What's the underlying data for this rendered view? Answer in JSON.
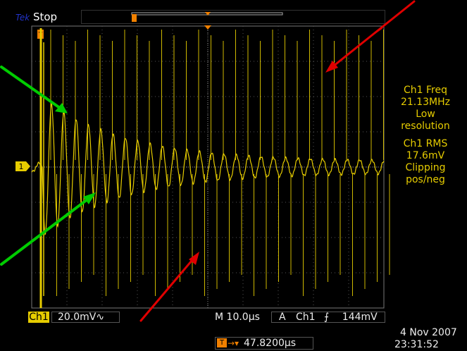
{
  "app": {
    "brand": "Tek",
    "run_state": "Stop"
  },
  "channel_marker": "1",
  "record_marker": "T",
  "measurements": [
    {
      "label": "Ch1 Freq",
      "value": "21.13MHz",
      "note": [
        "Low",
        "resolution"
      ]
    },
    {
      "label": "Ch1 RMS",
      "value": "17.6mV",
      "note": [
        "Clipping",
        "pos/neg"
      ]
    }
  ],
  "vertical": {
    "channel": "Ch1",
    "scale": "20.0mV",
    "coupling_symbol": "∿"
  },
  "horizontal": {
    "prefix": "M",
    "scale": "10.0µs"
  },
  "trigger": {
    "mode": "A",
    "source": "Ch1",
    "slope_symbol": "⨍",
    "level": "144mV"
  },
  "position": {
    "marker": "T",
    "arrow": "→▾",
    "value": "47.8200µs"
  },
  "datetime": {
    "date": "4 Nov 2007",
    "time": "23:31:52"
  },
  "colors": {
    "trace": "#e6cc00",
    "grid": "#666666",
    "marker": "#f08000",
    "arrow_red": "#e00000",
    "arrow_green": "#00cc00"
  },
  "annotations": [
    {
      "name": "green-arrow-upper",
      "color": "green"
    },
    {
      "name": "green-arrow-lower",
      "color": "green"
    },
    {
      "name": "red-arrow-upper-right",
      "color": "red"
    },
    {
      "name": "red-arrow-bottom-center",
      "color": "red"
    }
  ]
}
